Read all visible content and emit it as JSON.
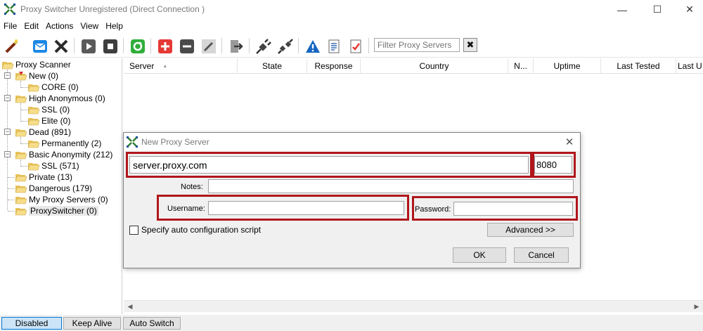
{
  "window": {
    "title": "Proxy Switcher Unregistered (Direct Connection )",
    "minimize_glyph": "—",
    "maximize_glyph": "☐",
    "close_glyph": "✕"
  },
  "menu": [
    "File",
    "Edit",
    "Actions",
    "View",
    "Help"
  ],
  "toolbar": {
    "icons": [
      "wizard-icon",
      "mail-download-icon",
      "delete-x-icon",
      "play-icon",
      "stop-icon",
      "refresh-icon",
      "add-icon",
      "remove-icon",
      "edit-pencil-icon",
      "export-arrow-icon",
      "plug-connect-icon",
      "plug-disconnect-icon",
      "warning-icon",
      "document-list-icon",
      "checklist-icon"
    ],
    "filter_placeholder": "Filter Proxy Servers",
    "filter_clear_glyph": "✖"
  },
  "tree": {
    "root": "Proxy Scanner",
    "items": [
      {
        "label": "New (0)"
      },
      {
        "label": "CORE (0)"
      },
      {
        "label": "High Anonymous (0)"
      },
      {
        "label": "SSL (0)"
      },
      {
        "label": "Elite (0)"
      },
      {
        "label": "Dead (891)"
      },
      {
        "label": "Permanently (2)"
      },
      {
        "label": "Basic Anonymity (212)"
      },
      {
        "label": "SSL (571)"
      },
      {
        "label": "Private (13)"
      },
      {
        "label": "Dangerous (179)"
      },
      {
        "label": "My Proxy Servers (0)"
      },
      {
        "label": "ProxySwitcher (0)"
      }
    ]
  },
  "grid": {
    "columns": [
      "Server",
      "State",
      "Response",
      "Country",
      "N...",
      "Uptime",
      "Last Tested",
      "Last U"
    ],
    "sort_glyph": "▲"
  },
  "statusbar": {
    "buttons": [
      "Disabled",
      "Keep Alive",
      "Auto Switch"
    ]
  },
  "dialog": {
    "title": "New Proxy Server",
    "close_glyph": "✕",
    "server_value": "server.proxy.com",
    "port_value": "8080",
    "notes_label": "Notes:",
    "username_label": "Username:",
    "password_label": "Password:",
    "checkbox_label": "Specify auto configuration script",
    "advanced_label": "Advanced >>",
    "ok_label": "OK",
    "cancel_label": "Cancel"
  },
  "colors": {
    "highlight_red": "#b0161b",
    "disabled_button_bg": "#cce4f7"
  }
}
